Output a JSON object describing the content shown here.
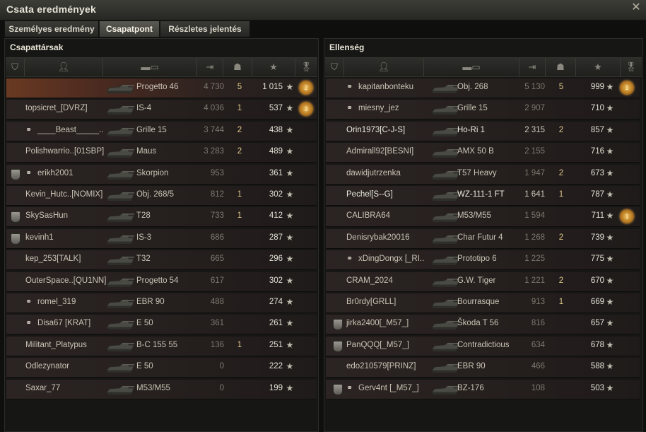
{
  "window": {
    "title": "Csata eredmények",
    "close_icon": "close-icon"
  },
  "tabs": [
    {
      "label": "Személyes eredmény",
      "active": false
    },
    {
      "label": "Csapatpont",
      "active": true
    },
    {
      "label": "Részletes jelentés",
      "active": false
    }
  ],
  "allies": {
    "title": "Csapattársak",
    "rows": [
      {
        "player": "",
        "vehicle": "Progetto 46",
        "damage": "4 730",
        "kills": "5",
        "xp": "1 015",
        "medal": "2",
        "highlight": true,
        "bright": false,
        "clan": false,
        "squad": false
      },
      {
        "player": "topsicret_[DVRZ]",
        "vehicle": "IS-4",
        "damage": "4 036",
        "kills": "1",
        "xp": "537",
        "medal": "3",
        "highlight": false,
        "bright": false,
        "clan": false,
        "squad": false
      },
      {
        "player": "____Beast_____..",
        "vehicle": "Grille 15",
        "damage": "3 744",
        "kills": "2",
        "xp": "438",
        "medal": "",
        "highlight": false,
        "bright": false,
        "clan": false,
        "squad": true
      },
      {
        "player": "Polishwarrio..[01SBP]",
        "vehicle": "Maus",
        "damage": "3 283",
        "kills": "2",
        "xp": "489",
        "medal": "",
        "highlight": false,
        "bright": false,
        "clan": false,
        "squad": false
      },
      {
        "player": "erikh2001",
        "vehicle": "Skorpion",
        "damage": "953",
        "kills": "",
        "xp": "361",
        "medal": "",
        "highlight": false,
        "bright": false,
        "clan": true,
        "squad": true
      },
      {
        "player": "Kevin_Hutc..[NOMIX]",
        "vehicle": "Obj. 268/5",
        "damage": "812",
        "kills": "1",
        "xp": "302",
        "medal": "",
        "highlight": false,
        "bright": false,
        "clan": false,
        "squad": false
      },
      {
        "player": "SkySasHun",
        "vehicle": "T28",
        "damage": "733",
        "kills": "1",
        "xp": "412",
        "medal": "",
        "highlight": false,
        "bright": false,
        "clan": true,
        "squad": false
      },
      {
        "player": "kevinh1",
        "vehicle": "IS-3",
        "damage": "686",
        "kills": "",
        "xp": "287",
        "medal": "",
        "highlight": false,
        "bright": false,
        "clan": true,
        "squad": false
      },
      {
        "player": "kep_253[TALK]",
        "vehicle": "T32",
        "damage": "665",
        "kills": "",
        "xp": "296",
        "medal": "",
        "highlight": false,
        "bright": false,
        "clan": false,
        "squad": false
      },
      {
        "player": "OuterSpace..[QU1NN]",
        "vehicle": "Progetto 54",
        "damage": "617",
        "kills": "",
        "xp": "302",
        "medal": "",
        "highlight": false,
        "bright": false,
        "clan": false,
        "squad": false
      },
      {
        "player": "romel_319",
        "vehicle": "EBR 90",
        "damage": "488",
        "kills": "",
        "xp": "274",
        "medal": "",
        "highlight": false,
        "bright": false,
        "clan": false,
        "squad": true
      },
      {
        "player": "Disa67 [KRAT]",
        "vehicle": "E 50",
        "damage": "361",
        "kills": "",
        "xp": "261",
        "medal": "",
        "highlight": false,
        "bright": false,
        "clan": false,
        "squad": true
      },
      {
        "player": "Militant_Platypus",
        "vehicle": "B-C 155 55",
        "damage": "136",
        "kills": "1",
        "xp": "251",
        "medal": "",
        "highlight": false,
        "bright": false,
        "clan": false,
        "squad": false
      },
      {
        "player": "Odlezynator",
        "vehicle": "E 50",
        "damage": "0",
        "kills": "",
        "xp": "222",
        "medal": "",
        "highlight": false,
        "bright": false,
        "clan": false,
        "squad": false
      },
      {
        "player": "Saxar_77",
        "vehicle": "M53/M55",
        "damage": "0",
        "kills": "",
        "xp": "199",
        "medal": "",
        "highlight": false,
        "bright": false,
        "clan": false,
        "squad": false
      }
    ]
  },
  "enemies": {
    "title": "Ellenség",
    "rows": [
      {
        "player": "kapitanbonteku",
        "vehicle": "Obj. 268",
        "damage": "5 130",
        "kills": "5",
        "xp": "999",
        "medal": "1",
        "highlight": false,
        "bright": false,
        "clan": false,
        "squad": true
      },
      {
        "player": "miesny_jez",
        "vehicle": "Grille 15",
        "damage": "2 907",
        "kills": "",
        "xp": "710",
        "medal": "",
        "highlight": false,
        "bright": false,
        "clan": false,
        "squad": true
      },
      {
        "player": "Orin1973[C-J-S]",
        "vehicle": "Ho-Ri 1",
        "damage": "2 315",
        "kills": "2",
        "xp": "857",
        "medal": "",
        "highlight": false,
        "bright": true,
        "clan": false,
        "squad": false
      },
      {
        "player": "Admirall92[BESNI]",
        "vehicle": "AMX 50 B",
        "damage": "2 155",
        "kills": "",
        "xp": "716",
        "medal": "",
        "highlight": false,
        "bright": false,
        "clan": false,
        "squad": false
      },
      {
        "player": "dawidjutrzenka",
        "vehicle": "T57 Heavy",
        "damage": "1 947",
        "kills": "2",
        "xp": "673",
        "medal": "",
        "highlight": false,
        "bright": false,
        "clan": false,
        "squad": false
      },
      {
        "player": "Pechel[S--G]",
        "vehicle": "WZ-111-1 FT",
        "damage": "1 641",
        "kills": "1",
        "xp": "787",
        "medal": "",
        "highlight": false,
        "bright": true,
        "clan": false,
        "squad": false
      },
      {
        "player": "CALIBRA64",
        "vehicle": "M53/M55",
        "damage": "1 594",
        "kills": "",
        "xp": "711",
        "medal": "1",
        "highlight": false,
        "bright": false,
        "clan": false,
        "squad": false
      },
      {
        "player": "Denisrybak20016",
        "vehicle": "Char Futur 4",
        "damage": "1 268",
        "kills": "2",
        "xp": "739",
        "medal": "",
        "highlight": false,
        "bright": false,
        "clan": false,
        "squad": false
      },
      {
        "player": "xDingDongx [_RI..",
        "vehicle": "Prototipo 6",
        "damage": "1 225",
        "kills": "",
        "xp": "775",
        "medal": "",
        "highlight": false,
        "bright": false,
        "clan": false,
        "squad": true
      },
      {
        "player": "CRAM_2024",
        "vehicle": "G.W. Tiger",
        "damage": "1 221",
        "kills": "2",
        "xp": "670",
        "medal": "",
        "highlight": false,
        "bright": false,
        "clan": false,
        "squad": false
      },
      {
        "player": "Br0rdy[GRLL]",
        "vehicle": "Bourrasque",
        "damage": "913",
        "kills": "1",
        "xp": "669",
        "medal": "",
        "highlight": false,
        "bright": false,
        "clan": false,
        "squad": false
      },
      {
        "player": "jirka2400[_M57_]",
        "vehicle": "Škoda T 56",
        "damage": "816",
        "kills": "",
        "xp": "657",
        "medal": "",
        "highlight": false,
        "bright": false,
        "clan": true,
        "squad": false
      },
      {
        "player": "PanQQQ[_M57_]",
        "vehicle": "Contradictious",
        "damage": "634",
        "kills": "",
        "xp": "678",
        "medal": "",
        "highlight": false,
        "bright": false,
        "clan": true,
        "squad": false
      },
      {
        "player": "edo210579[PRINZ]",
        "vehicle": "EBR 90",
        "damage": "466",
        "kills": "",
        "xp": "588",
        "medal": "",
        "highlight": false,
        "bright": false,
        "clan": false,
        "squad": false
      },
      {
        "player": "Gerv4nt [_M57_]",
        "vehicle": "BZ-176",
        "damage": "108",
        "kills": "",
        "xp": "503",
        "medal": "",
        "highlight": false,
        "bright": false,
        "clan": true,
        "squad": true
      }
    ]
  }
}
